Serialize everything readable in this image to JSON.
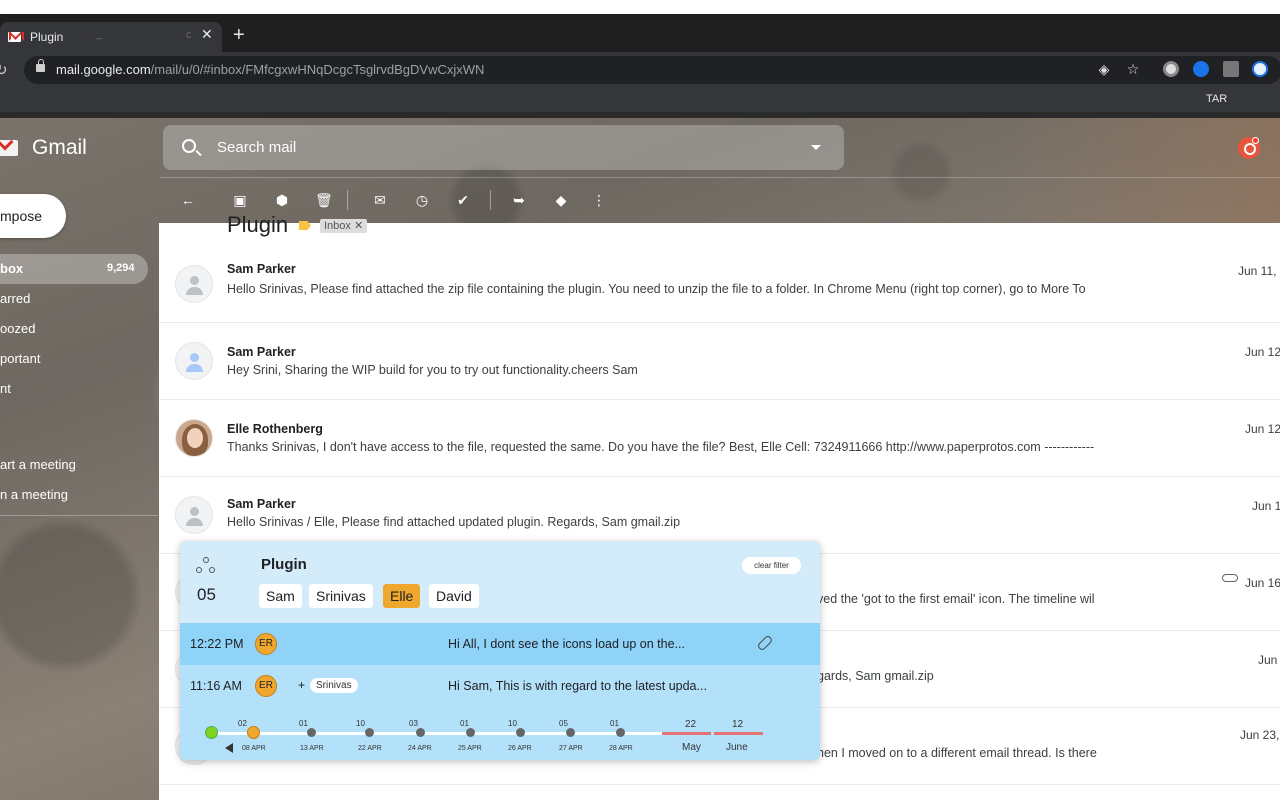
{
  "browser": {
    "tab_title": "Plugin",
    "tab_ghost_1": "_",
    "tab_ghost_2": "c",
    "tab_close": "✕",
    "new_tab": "+",
    "url_host": "mail.google.com",
    "url_path": "/mail/u/0/#inbox/FMfcgxwHNqDcgcTsglrvdBgDVwCxjxWN",
    "bookmark_label": "TAR"
  },
  "gmail": {
    "brand": "Gmail",
    "search": {
      "placeholder": "Search mail"
    },
    "compose_label": "mpose",
    "nav": [
      {
        "label": "box",
        "count": "9,294"
      },
      {
        "label": "arred"
      },
      {
        "label": "oozed"
      },
      {
        "label": "portant"
      },
      {
        "label": "nt"
      },
      {
        "label": "art a meeting"
      },
      {
        "label": "n a meeting"
      }
    ],
    "thread": {
      "title": "Plugin",
      "label_chip": "Inbox ✕"
    }
  },
  "emails": [
    {
      "sender": "Sam Parker",
      "snippet": "Hello Srinivas, Please find attached the zip file containing the plugin. You need to unzip the file to a folder. In Chrome Menu (right top corner), go to More To",
      "date": "Jun 11,"
    },
    {
      "sender": "Sam Parker",
      "snippet": "Hey Srini,  Sharing the WIP build for you to try out functionality.cheers Sam",
      "date": "Jun 12"
    },
    {
      "sender": "Elle Rothenberg",
      "snippet": "Thanks Srinivas, I don't have access to the file, requested the same. Do you have the file? Best, Elle    Cell: 7324911666 http://www.paperprotos.com ------------",
      "date": "Jun 12"
    },
    {
      "sender": "Sam Parker",
      "snippet": "Hello Srinivas / Elle,    Please find attached updated plugin. Regards, Sam    gmail.zip",
      "date": "Jun 1"
    },
    {
      "sender": "",
      "snippet": "ved the 'got to the first email' icon. The timeline wil",
      "date": "Jun 16"
    },
    {
      "sender": "",
      "snippet": "gards, Sam    gmail.zip",
      "date": "Jun"
    },
    {
      "sender": "",
      "snippet": "hen I moved on to a different email thread. Is there",
      "date": "Jun 23,"
    }
  ],
  "plugin": {
    "count": "05",
    "title": "Plugin",
    "clear_filter": "clear filter",
    "people": [
      {
        "name": "Sam",
        "active": false
      },
      {
        "name": "Srinivas",
        "active": false
      },
      {
        "name": "Elle",
        "active": true
      },
      {
        "name": "David",
        "active": false
      }
    ],
    "messages": [
      {
        "time": "12:22 PM",
        "initials": "ER",
        "text": "Hi All, I dont see the icons load up on the...",
        "attachment": true
      },
      {
        "time": "11:16 AM",
        "initials": "ER",
        "plus": "+",
        "cc": "Srinivas",
        "text": "Hi Sam, This is with regard to the latest upda...",
        "attachment": false
      }
    ],
    "timeline": {
      "points": [
        {
          "top": "02",
          "bottom": "08 APR"
        },
        {
          "top": "01",
          "bottom": "13 APR"
        },
        {
          "top": "10",
          "bottom": "22 APR"
        },
        {
          "top": "03",
          "bottom": "24 APR"
        },
        {
          "top": "01",
          "bottom": "25 APR"
        },
        {
          "top": "10",
          "bottom": "26 APR"
        },
        {
          "top": "05",
          "bottom": "27 APR"
        },
        {
          "top": "01",
          "bottom": "28 APR"
        }
      ],
      "months": [
        {
          "count": "22",
          "name": "May"
        },
        {
          "count": "12",
          "name": "June"
        }
      ]
    }
  }
}
